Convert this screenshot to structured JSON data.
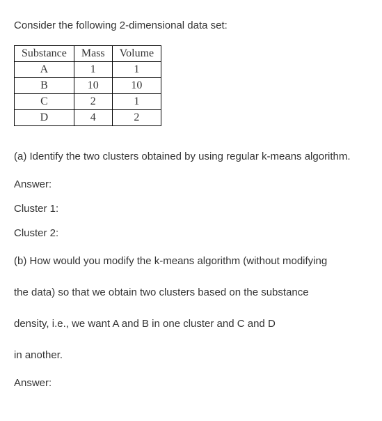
{
  "intro": "Consider the following 2-dimensional data set:",
  "table": {
    "headers": [
      "Substance",
      "Mass",
      "Volume"
    ],
    "rows": [
      [
        "A",
        "1",
        "1"
      ],
      [
        "B",
        "10",
        "10"
      ],
      [
        "C",
        "2",
        "1"
      ],
      [
        "D",
        "4",
        "2"
      ]
    ]
  },
  "qa_text": "(a) Identify the two clusters obtained by using regular k-means algorithm.",
  "answer_label": "Answer:",
  "cluster1": "Cluster 1:",
  "cluster2": "Cluster 2:",
  "qb_line1": "(b) How would you modify the k-means algorithm (without modifying",
  "qb_line2": "the data) so that we obtain two clusters based on the substance",
  "qb_line3": "density, i.e., we want A and B in one cluster and C and D",
  "qb_line4": "in another.",
  "answer_label_b": "Answer:"
}
